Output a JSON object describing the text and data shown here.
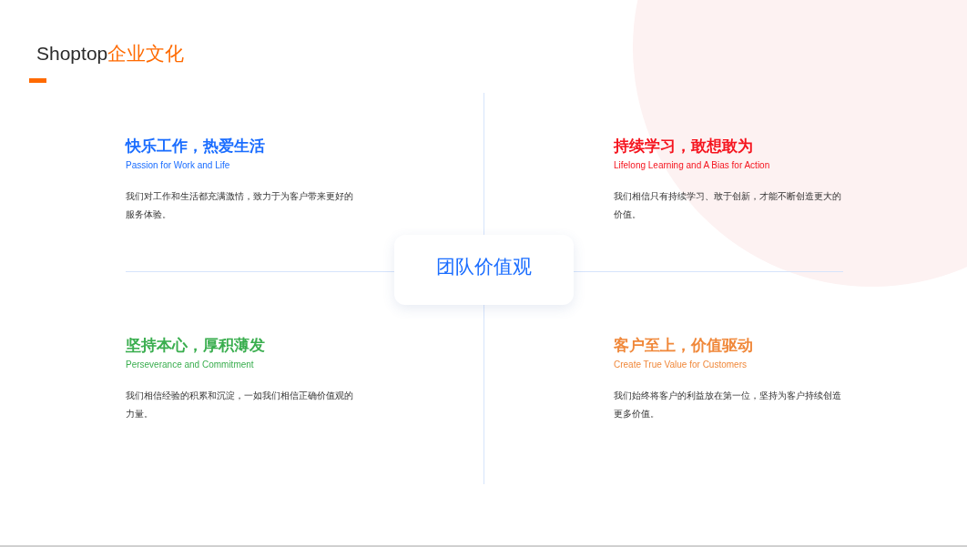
{
  "header": {
    "brand": "Shoptop",
    "title": "企业文化"
  },
  "center": {
    "title": "团队价值观"
  },
  "values": [
    {
      "title": "快乐工作，热爱生活",
      "subtitle": "Passion for Work and Life",
      "text": "我们对工作和生活都充满激情，致力于为客户带来更好的服务体验。",
      "color": "#1a6dff"
    },
    {
      "title": "持续学习，敢想敢为",
      "subtitle": "Lifelong Learning and A Bias for Action",
      "text": "我们相信只有持续学习、敢于创新，才能不断创造更大的价值。",
      "color": "#f5141e"
    },
    {
      "title": "坚持本心，厚积薄发",
      "subtitle": "Perseverance and Commitment",
      "text": "我们相信经验的积累和沉淀，一如我们相信正确价值观的力量。",
      "color": "#3aae4f"
    },
    {
      "title": "客户至上，价值驱动",
      "subtitle": "Create True Value for Customers",
      "text": "我们始终将客户的利益放在第一位，坚持为客户持续创造更多价值。",
      "color": "#f0883a"
    }
  ]
}
